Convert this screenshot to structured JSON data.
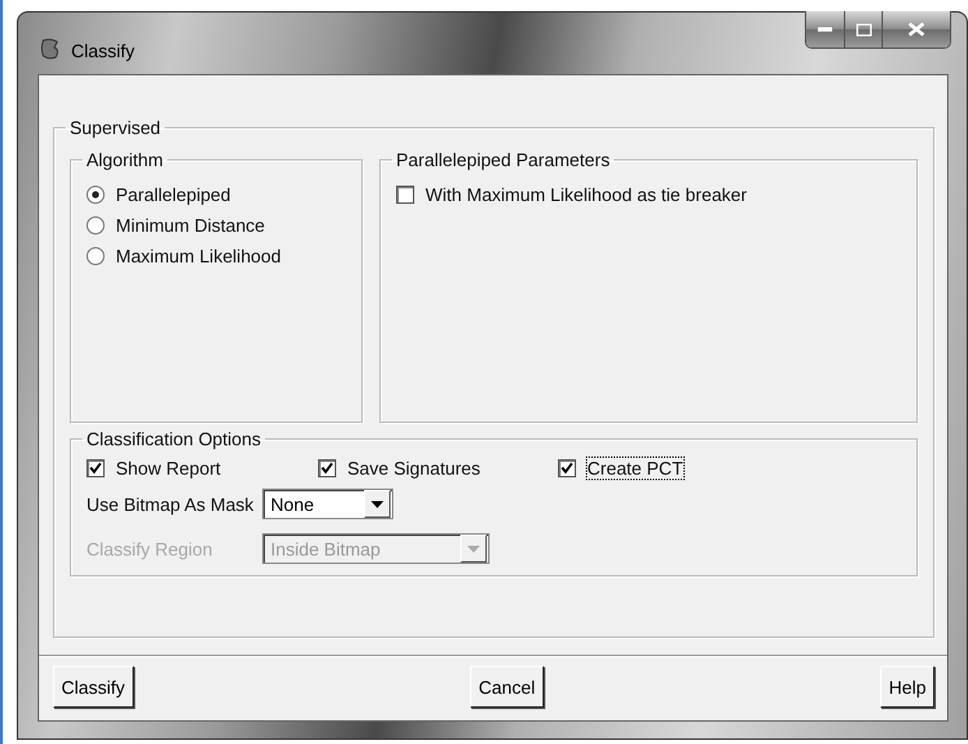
{
  "window": {
    "title": "Classify"
  },
  "supervised": {
    "title": "Supervised",
    "algorithm": {
      "title": "Algorithm",
      "options": [
        {
          "label": "Parallelepiped",
          "selected": true
        },
        {
          "label": "Minimum Distance",
          "selected": false
        },
        {
          "label": "Maximum Likelihood",
          "selected": false
        }
      ]
    },
    "parameters": {
      "title": "Parallelepiped Parameters",
      "options": [
        {
          "label": "With Maximum Likelihood as tie breaker",
          "checked": false
        }
      ]
    },
    "classification_options": {
      "title": "Classification Options",
      "checkboxes": [
        {
          "label": "Show Report",
          "checked": true,
          "focused": false
        },
        {
          "label": "Save Signatures",
          "checked": true,
          "focused": false
        },
        {
          "label": "Create PCT",
          "checked": true,
          "focused": true
        }
      ],
      "mask": {
        "label": "Use Bitmap As Mask",
        "value": "None",
        "disabled": false
      },
      "region": {
        "label": "Classify Region",
        "value": "Inside Bitmap",
        "disabled": true
      }
    }
  },
  "buttons": [
    "Classify",
    "Cancel",
    "Help"
  ]
}
